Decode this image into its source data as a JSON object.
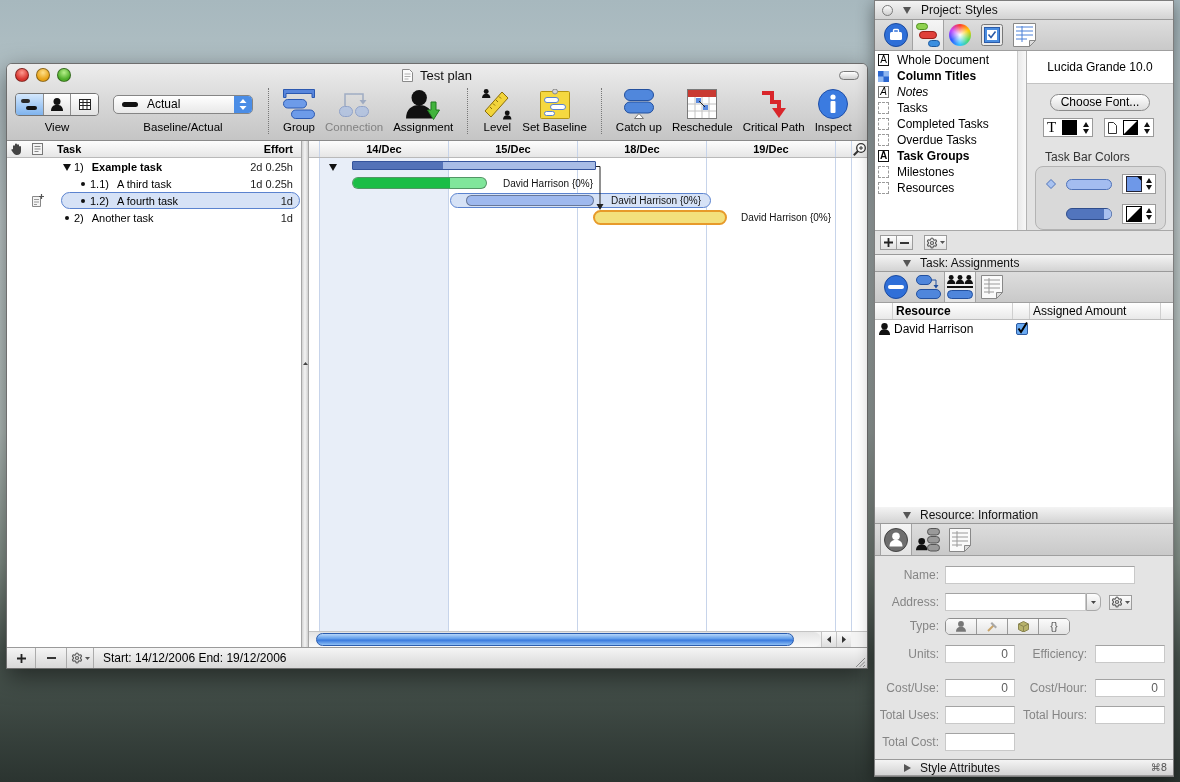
{
  "window": {
    "title": "Test plan"
  },
  "toolbar": {
    "view": {
      "label": "View",
      "segments": [
        {
          "kind": "gantt",
          "selected": true
        },
        {
          "kind": "resources",
          "selected": false
        },
        {
          "kind": "calendar",
          "selected": false
        }
      ]
    },
    "baseline": {
      "label": "Baseline/Actual",
      "value": "Actual"
    },
    "groups": [
      {
        "buttons": [
          {
            "kind": "group",
            "label": "Group",
            "disabled": false
          },
          {
            "kind": "connection",
            "label": "Connection",
            "disabled": true
          },
          {
            "kind": "assignment",
            "label": "Assignment",
            "disabled": false
          }
        ]
      },
      {
        "buttons": [
          {
            "kind": "level",
            "label": "Level",
            "disabled": false
          },
          {
            "kind": "baseline",
            "label": "Set Baseline",
            "disabled": false
          }
        ]
      },
      {
        "buttons": [
          {
            "kind": "catchup",
            "label": "Catch up",
            "disabled": false
          },
          {
            "kind": "reschedule",
            "label": "Reschedule",
            "disabled": false
          },
          {
            "kind": "critical",
            "label": "Critical Path",
            "disabled": false
          },
          {
            "kind": "inspect",
            "label": "Inspect",
            "disabled": false
          }
        ]
      }
    ]
  },
  "outline": {
    "columns": [
      {
        "label": "Task"
      },
      {
        "label": "Effort"
      }
    ],
    "rows": [
      {
        "number": "1)",
        "name": "Example task",
        "effort": "2d 0.25h",
        "expanded": true,
        "selected": false,
        "bar": {
          "kind": "group",
          "level": 0.37
        },
        "children": [
          {
            "number": "1.1)",
            "name": "A third task",
            "effort": "1d 0.25h",
            "selected": false,
            "bar": {
              "kind": "task",
              "color": "#80e69b",
              "level": 0.73,
              "label": "David Harrison {0%}"
            }
          },
          {
            "number": "1.2)",
            "name": "A fourth task",
            "effort": "1d",
            "selected": true,
            "bar": {
              "kind": "task",
              "color": "#9fb9ee",
              "label": "David Harrison {0%}"
            }
          }
        ]
      },
      {
        "number": "2)",
        "name": "Another task",
        "effort": "1d",
        "selected": false,
        "bar": {
          "kind": "critical",
          "color": "#f3e07c",
          "label": "David Harrison {0%}",
          "linked": true
        }
      }
    ]
  },
  "gantt": {
    "dates": [
      "14/Dec",
      "15/Dec",
      "18/Dec",
      "19/Dec"
    ]
  },
  "status_bar": {
    "text": "Start: 14/12/2006 End: 19/12/2006"
  },
  "inspector": {
    "styles": {
      "title": "Project: Styles",
      "expanded": true,
      "tabs": [
        {
          "kind": "project",
          "selected": false
        },
        {
          "kind": "styles",
          "selected": true
        },
        {
          "kind": "colors",
          "selected": false
        },
        {
          "kind": "checklist",
          "selected": false
        },
        {
          "kind": "table",
          "selected": false
        }
      ],
      "items": [
        {
          "name": "Whole Document",
          "kind": "letter",
          "marker": "A",
          "bold": false,
          "italic": false
        },
        {
          "name": "Column Titles",
          "kind": "pattern",
          "bold": true,
          "italic": false
        },
        {
          "name": "Notes",
          "kind": "letter",
          "marker": "A",
          "bold": false,
          "italic": true
        },
        {
          "name": "Tasks",
          "kind": "empty",
          "bold": false,
          "italic": false
        },
        {
          "name": "Completed Tasks",
          "kind": "empty",
          "bold": false,
          "italic": false
        },
        {
          "name": "Overdue Tasks",
          "kind": "empty",
          "bold": false,
          "italic": false
        },
        {
          "name": "Task Groups",
          "kind": "letter",
          "marker": "A",
          "bold": true,
          "italic": false
        },
        {
          "name": "Milestones",
          "kind": "empty",
          "bold": false,
          "italic": false
        },
        {
          "name": "Resources",
          "kind": "empty",
          "bold": false,
          "italic": false
        }
      ],
      "font_name": "Lucida Grande 10.0",
      "choose_font": "Choose Font...",
      "text_well_marker": "T",
      "bar_colors_title": "Task Bar Colors"
    },
    "assignments": {
      "title": "Task: Assignments",
      "expanded": true,
      "tabs": [
        {
          "kind": "task",
          "selected": false
        },
        {
          "kind": "dependencies",
          "selected": false
        },
        {
          "kind": "assignments",
          "selected": true
        },
        {
          "kind": "notes",
          "selected": false
        }
      ],
      "columns": [
        {
          "label": "Resource"
        },
        {
          "label": "Assigned Amount"
        }
      ],
      "rows": [
        {
          "name": "David Harrison",
          "checked": true
        }
      ]
    },
    "resource": {
      "title": "Resource: Information",
      "expanded": true,
      "tabs": [
        {
          "kind": "resource",
          "selected": true
        },
        {
          "kind": "schedule",
          "selected": false
        },
        {
          "kind": "notes",
          "selected": false
        }
      ],
      "disabled": true,
      "name": {
        "label": "Name:"
      },
      "address": {
        "label": "Address:"
      },
      "type": {
        "label": "Type:",
        "segments": [
          {
            "kind": "person"
          },
          {
            "kind": "tool"
          },
          {
            "kind": "material"
          },
          {
            "kind": "group",
            "label": "{}"
          }
        ]
      },
      "units": {
        "label": "Units:",
        "value": "0"
      },
      "efficiency": {
        "label": "Efficiency:"
      },
      "cost_per_use": {
        "label": "Cost/Use:",
        "value": "0"
      },
      "cost_per_hour": {
        "label": "Cost/Hour:",
        "value": "0"
      },
      "total_uses": {
        "label": "Total Uses:"
      },
      "total_hours": {
        "label": "Total Hours:"
      },
      "total_cost": {
        "label": "Total Cost:"
      }
    },
    "footer": {
      "title": "Style Attributes",
      "expanded": false,
      "shortcut": "⌘8"
    }
  }
}
